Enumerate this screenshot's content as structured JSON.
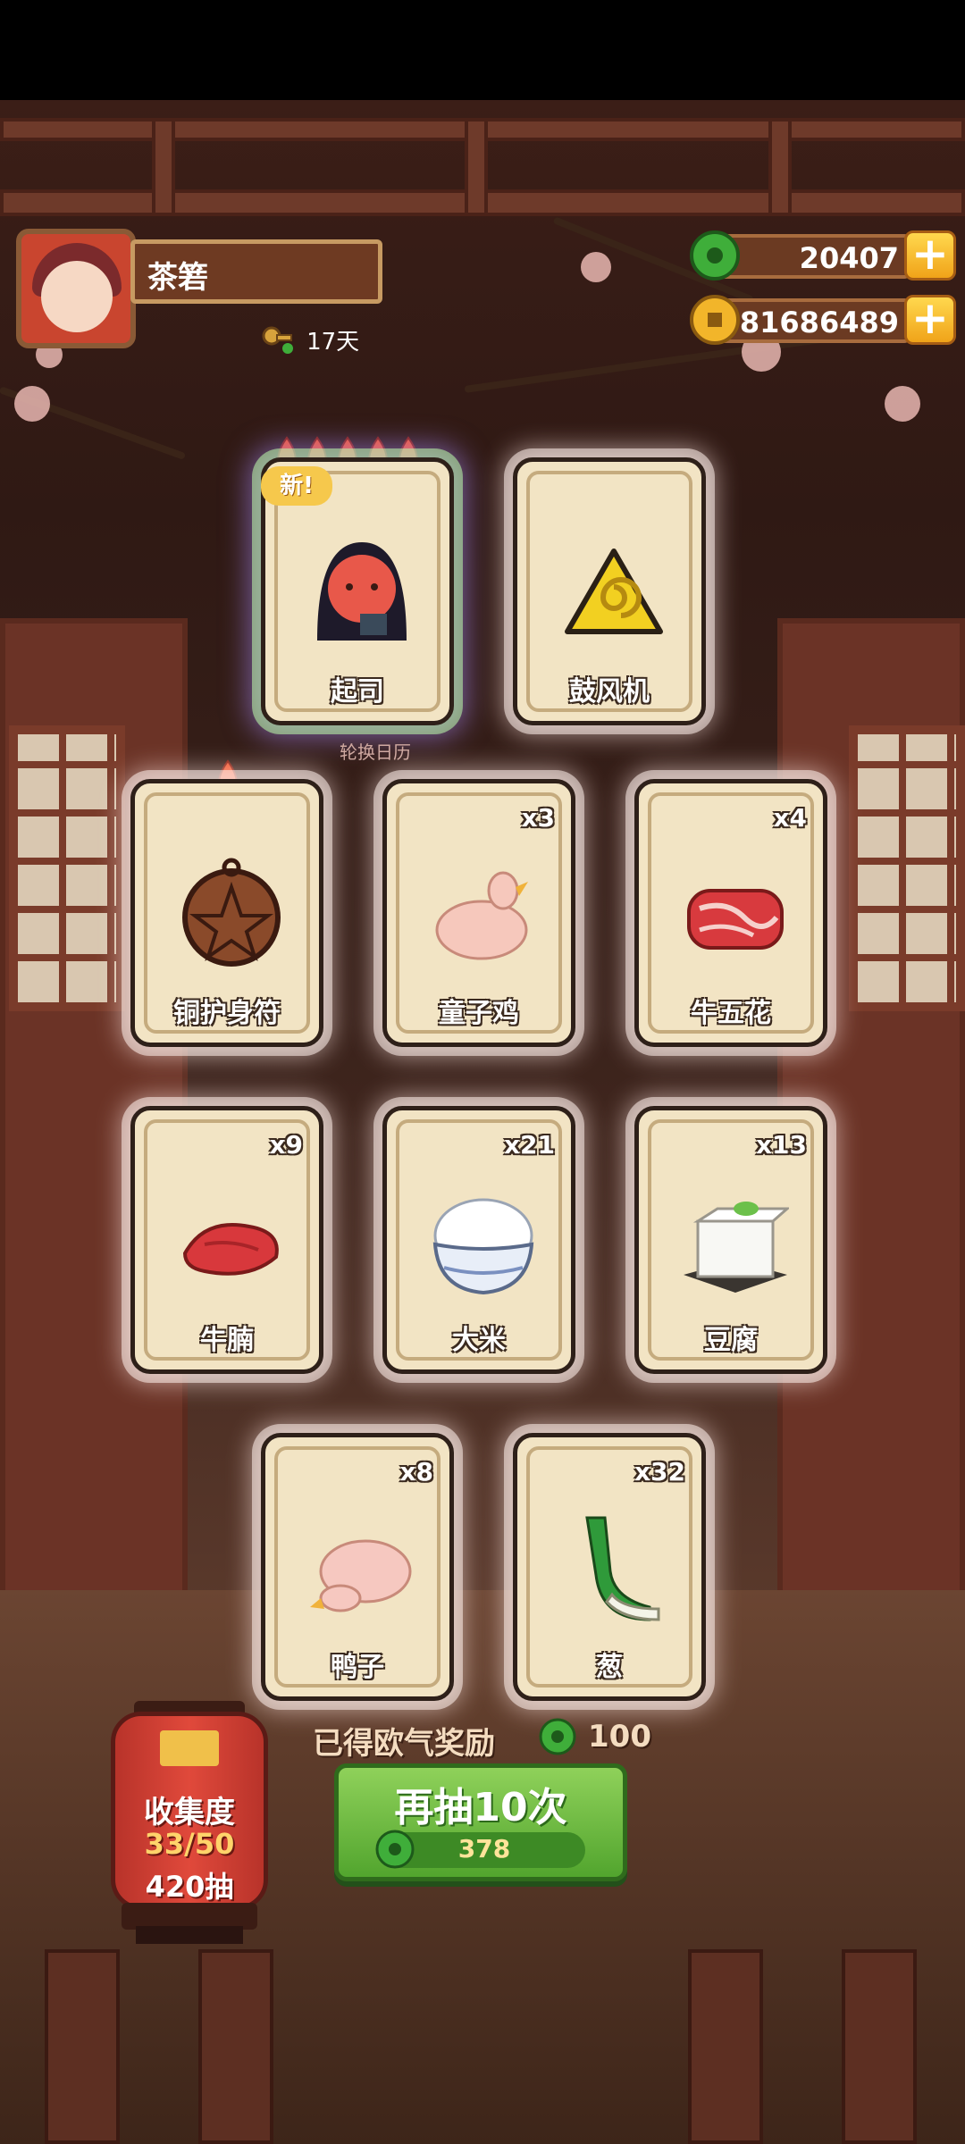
{
  "player": {
    "name": "茶箬",
    "days": "17天"
  },
  "currency": {
    "jade": "20407",
    "coins": "81686489"
  },
  "banner": {
    "calendar_label": "轮换日历"
  },
  "cards": [
    {
      "label": "起司",
      "count": "",
      "badge": "新!",
      "flames": 5,
      "rarity": "rare",
      "icon": "cheese-character-icon"
    },
    {
      "label": "鼓风机",
      "count": "",
      "icon": "blower-icon"
    },
    {
      "label": "铜护身符",
      "count": "",
      "flames": 1,
      "icon": "copper-amulet-icon"
    },
    {
      "label": "童子鸡",
      "count": "x3",
      "icon": "chicken-icon"
    },
    {
      "label": "牛五花",
      "count": "x4",
      "icon": "beef-belly-icon"
    },
    {
      "label": "牛腩",
      "count": "x9",
      "icon": "beef-brisket-icon"
    },
    {
      "label": "大米",
      "count": "x21",
      "icon": "rice-bowl-icon"
    },
    {
      "label": "豆腐",
      "count": "x13",
      "icon": "tofu-icon"
    },
    {
      "label": "鸭子",
      "count": "x8",
      "icon": "duck-icon"
    },
    {
      "label": "葱",
      "count": "x32",
      "icon": "scallion-icon"
    }
  ],
  "reward": {
    "text": "已得欧气奖励",
    "value": "100"
  },
  "draw_button": {
    "label": "再抽10次",
    "cost": "378"
  },
  "collection": {
    "title": "收集度",
    "progress": "33/50",
    "draws": "420抽"
  },
  "colors": {
    "jade": "#3fae3a",
    "coin": "#f2b52a",
    "button": "#6cbf3f",
    "lantern": "#d63f33"
  }
}
